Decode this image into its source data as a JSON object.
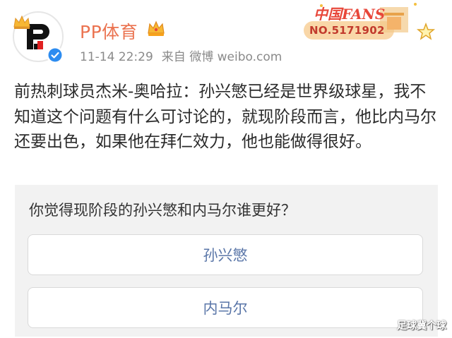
{
  "header": {
    "username": "PP体育",
    "timestamp": "11-14 22:29",
    "source": "来自 微博 weibo.com",
    "fans_badge": {
      "title": "中国FANS",
      "number": "NO.5171902"
    }
  },
  "post": {
    "text": "前热刺球员杰米-奥哈拉：孙兴慜已经是世界级球星，我不知道这个问题有什么可讨论的，就现阶段而言，他比内马尔还要出色，如果他在拜仁效力，他也能做得很好。"
  },
  "poll": {
    "question": "你觉得现阶段的孙兴慜和内马尔谁更好？",
    "options": [
      {
        "label": "孙兴慜"
      },
      {
        "label": "内马尔"
      }
    ]
  },
  "watermark": "足球冀个球",
  "colors": {
    "username": "#eb7350",
    "meta": "#8a8a8a",
    "option_text": "#5a76a8",
    "poll_bg": "#f2f2f2",
    "verify": "#2d8cf0"
  },
  "icons": {
    "avatar": "pp-sports-logo",
    "verify": "verified-check-icon",
    "vip": "vip-crown-icon",
    "avatar_decoration": "crown-icon",
    "badge_star": "star-icon"
  }
}
